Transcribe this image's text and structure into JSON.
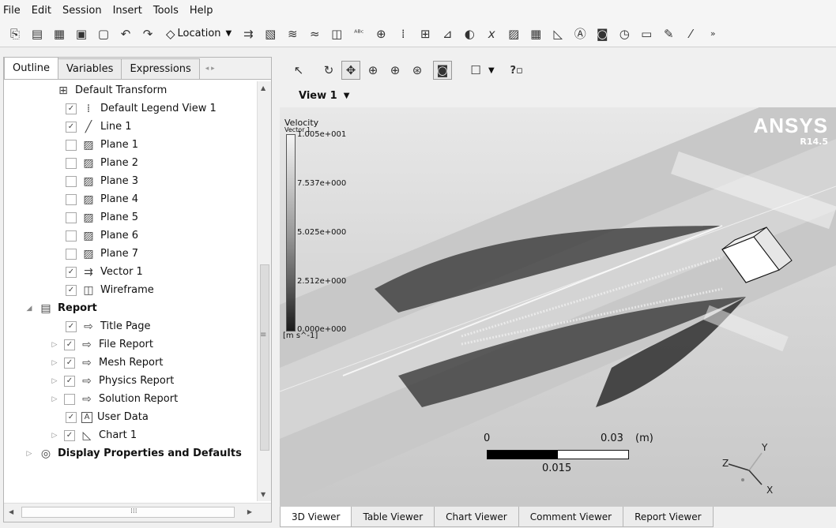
{
  "menu": [
    "File",
    "Edit",
    "Session",
    "Insert",
    "Tools",
    "Help"
  ],
  "toolbar": {
    "location_label": "Location",
    "icons": [
      "new-icon",
      "open-icon",
      "save-icon",
      "print-icon",
      "image-icon",
      "undo-icon",
      "redo-icon",
      "vector-icon",
      "contour-icon",
      "streamline-icon",
      "volume-icon",
      "isosurface-icon",
      "text-icon",
      "clip-icon",
      "legend-icon",
      "transform-icon",
      "color-icon",
      "light-icon",
      "variable-icon",
      "expression-icon",
      "table-icon",
      "chart-icon",
      "comment-icon",
      "figure-icon",
      "time-icon",
      "animation-icon",
      "quick-edit-icon",
      "probe-icon",
      "more-icon"
    ]
  },
  "left_tabs": [
    "Outline",
    "Variables",
    "Expressions"
  ],
  "tree": [
    {
      "label": "Default Transform",
      "icon": "transform-icon",
      "checkbox": null
    },
    {
      "label": "Default Legend View 1",
      "icon": "legend-icon",
      "checkbox": true
    },
    {
      "label": "Line 1",
      "icon": "line-icon",
      "checkbox": true
    },
    {
      "label": "Plane 1",
      "icon": "plane-icon",
      "checkbox": false
    },
    {
      "label": "Plane 2",
      "icon": "plane-icon",
      "checkbox": false
    },
    {
      "label": "Plane 3",
      "icon": "plane-icon",
      "checkbox": false
    },
    {
      "label": "Plane 4",
      "icon": "plane-icon",
      "checkbox": false
    },
    {
      "label": "Plane 5",
      "icon": "plane-icon",
      "checkbox": false
    },
    {
      "label": "Plane 6",
      "icon": "plane-icon",
      "checkbox": false
    },
    {
      "label": "Plane 7",
      "icon": "plane-icon",
      "checkbox": false
    },
    {
      "label": "Vector 1",
      "icon": "vector-icon",
      "checkbox": true
    },
    {
      "label": "Wireframe",
      "icon": "wireframe-icon",
      "checkbox": true
    },
    {
      "label": "Report",
      "icon": "report-icon",
      "checkbox": null,
      "bold": true,
      "expanded": true
    },
    {
      "label": "Title Page",
      "icon": "report-page-icon",
      "checkbox": true
    },
    {
      "label": "File Report",
      "icon": "report-page-icon",
      "checkbox": true,
      "expander": true
    },
    {
      "label": "Mesh Report",
      "icon": "report-page-icon",
      "checkbox": true,
      "expander": true
    },
    {
      "label": "Physics Report",
      "icon": "report-page-icon",
      "checkbox": true,
      "expander": true
    },
    {
      "label": "Solution Report",
      "icon": "report-page-icon",
      "checkbox": false,
      "expander": true
    },
    {
      "label": "User Data",
      "icon": "text-icon",
      "checkbox": true
    },
    {
      "label": "Chart 1",
      "icon": "chart-icon",
      "checkbox": true,
      "expander": true
    },
    {
      "label": "Display Properties and Defaults",
      "icon": "display-icon",
      "checkbox": null,
      "bold": true,
      "expander": true
    }
  ],
  "viewer": {
    "view_title": "View 1",
    "legend": {
      "title": "Velocity",
      "subtitle": "Vector 1",
      "levels": [
        "1.005e+001",
        "7.537e+000",
        "5.025e+000",
        "2.512e+000",
        "0.000e+000"
      ],
      "unit": "[m s^-1]"
    },
    "brand": {
      "name": "ANSYS",
      "version": "R14.5"
    },
    "scale": {
      "zero": "0",
      "mid": "0.015",
      "end": "0.03",
      "unit": "(m)"
    },
    "axes": {
      "x": "X",
      "y": "Y",
      "z": "Z"
    },
    "tabs": [
      "3D Viewer",
      "Table Viewer",
      "Chart Viewer",
      "Comment Viewer",
      "Report Viewer"
    ]
  }
}
